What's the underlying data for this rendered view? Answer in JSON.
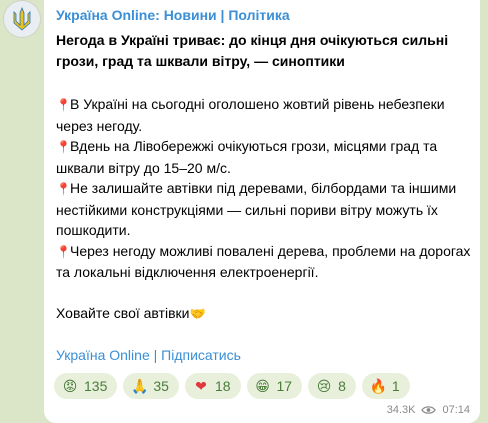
{
  "channel": {
    "name": "Україна Online: Новини | Політика"
  },
  "post": {
    "headline": "Негода в Україні триває: до кінця дня очікуються сильні грози, град та шквали вітру, — синоптики",
    "paragraphs": [
      {
        "icon": "round-pushpin-icon",
        "text": "В Україні на сьогодні оголошено жовтий рівень небезпеки через негоду."
      },
      {
        "icon": "round-pushpin-icon",
        "text": "Вдень на Лівобережжі очікуються грози, місцями град та шквали вітру до 15–20 м/с."
      },
      {
        "icon": "round-pushpin-icon",
        "text": "Не залишайте автівки під деревами, білбордами та іншими нестійкими конструкціями — сильні пориви вітру можуть їх пошкодити."
      },
      {
        "icon": "round-pushpin-icon",
        "text": "Через негоду можливі повалені дерева, проблеми на дорогах та локальні відключення електроенергії."
      }
    ],
    "closing": "Ховайте свої автівки",
    "closing_icon": "handshake-icon",
    "subscribe_link": "Україна Online | Підписатись"
  },
  "reactions": [
    {
      "icon": "angry-face-icon",
      "glyph": "😡",
      "count": "135"
    },
    {
      "icon": "folded-hands-icon",
      "glyph": "🙏",
      "count": "35"
    },
    {
      "icon": "red-heart-icon",
      "glyph": "❤",
      "count": "18"
    },
    {
      "icon": "grinning-face-icon",
      "glyph": "😁",
      "count": "17"
    },
    {
      "icon": "crying-face-icon",
      "glyph": "😢",
      "count": "8"
    },
    {
      "icon": "fire-icon",
      "glyph": "🔥",
      "count": "1"
    }
  ],
  "meta": {
    "views": "34.3K",
    "time": "07:14"
  },
  "colors": {
    "link": "#3a8fd6",
    "reaction_bg": "#e8f0dc",
    "reaction_text": "#4a7c3a",
    "pin": "#e0383e"
  }
}
